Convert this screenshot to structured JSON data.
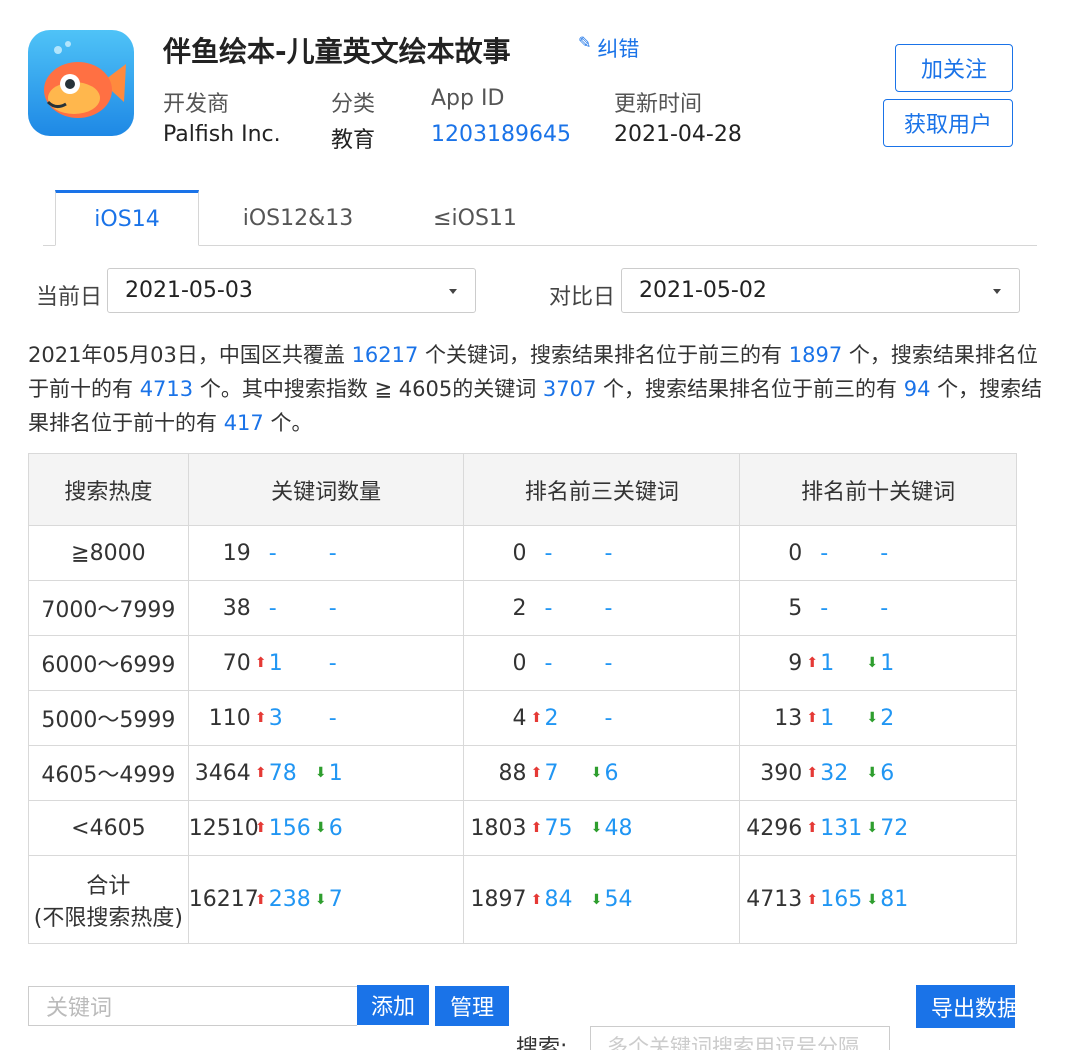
{
  "app": {
    "title": "伴鱼绘本-儿童英文绘本故事",
    "fix_label": "纠错",
    "icon": "fish-app-icon",
    "meta": [
      {
        "label": "开发商",
        "value": "Palfish Inc."
      },
      {
        "label": "分类",
        "value": "教育"
      },
      {
        "label": "App ID",
        "value": "1203189645"
      },
      {
        "label": "更新时间",
        "value": "2021-04-28"
      }
    ],
    "follow_label": "加关注",
    "get_users_label": "获取用户"
  },
  "tabs": [
    "iOS14",
    "iOS12&13",
    "≤iOS11"
  ],
  "active_tab": "iOS14",
  "dates": {
    "current_label": "当前日",
    "current_value": "2021-05-03",
    "compare_label": "对比日",
    "compare_value": "2021-05-02"
  },
  "summary": {
    "t1": "2021年05月03日，中国区共覆盖 ",
    "n1": "16217",
    "t2": " 个关键词，搜索结果排名位于前三的有 ",
    "n2": "1897",
    "t3": " 个，搜索结果排名位于前十的有 ",
    "n3": "4713",
    "t4": " 个。其中搜索指数 ≧ 4605的关键词 ",
    "n4": "3707",
    "t5": " 个，搜索结果排名位于前三的有 ",
    "n5": "94",
    "t6": " 个，搜索结果排名位于前十的有 ",
    "n6": "417",
    "t7": " 个。"
  },
  "table": {
    "headers": [
      "搜索热度",
      "关键词数量",
      "排名前三关键词",
      "排名前十关键词"
    ],
    "rows": [
      {
        "heat": "≧8000",
        "cells": [
          {
            "n": "19",
            "up": "-",
            "down": "-"
          },
          {
            "n": "0",
            "up": "-",
            "down": "-"
          },
          {
            "n": "0",
            "up": "-",
            "down": "-"
          }
        ]
      },
      {
        "heat": "7000～7999",
        "cells": [
          {
            "n": "38",
            "up": "-",
            "down": "-"
          },
          {
            "n": "2",
            "up": "-",
            "down": "-"
          },
          {
            "n": "5",
            "up": "-",
            "down": "-"
          }
        ]
      },
      {
        "heat": "6000～6999",
        "cells": [
          {
            "n": "70",
            "up": "1",
            "down": "-"
          },
          {
            "n": "0",
            "up": "-",
            "down": "-"
          },
          {
            "n": "9",
            "up": "1",
            "down": "1"
          }
        ]
      },
      {
        "heat": "5000～5999",
        "cells": [
          {
            "n": "110",
            "up": "3",
            "down": "-"
          },
          {
            "n": "4",
            "up": "2",
            "down": "-"
          },
          {
            "n": "13",
            "up": "1",
            "down": "2"
          }
        ]
      },
      {
        "heat": "4605～4999",
        "cells": [
          {
            "n": "3464",
            "up": "78",
            "down": "1"
          },
          {
            "n": "88",
            "up": "7",
            "down": "6"
          },
          {
            "n": "390",
            "up": "32",
            "down": "6"
          }
        ]
      },
      {
        "heat": "<4605",
        "cells": [
          {
            "n": "12510",
            "up": "156",
            "down": "6"
          },
          {
            "n": "1803",
            "up": "75",
            "down": "48"
          },
          {
            "n": "4296",
            "up": "131",
            "down": "72"
          }
        ]
      },
      {
        "heat": "合计",
        "heat2": "(不限搜索热度)",
        "cells": [
          {
            "n": "16217",
            "up": "238",
            "down": "7"
          },
          {
            "n": "1897",
            "up": "84",
            "down": "54"
          },
          {
            "n": "4713",
            "up": "165",
            "down": "81"
          }
        ]
      }
    ]
  },
  "bottom": {
    "keyword_placeholder": "关键词",
    "add_label": "添加",
    "manage_label": "管理",
    "export_label": "导出数据",
    "search_label": "搜索:",
    "search_placeholder": "多个关键词搜索用逗号分隔"
  },
  "colors": {
    "accent": "#1a73e8",
    "up": "#e53935",
    "down": "#2e9e2e"
  }
}
